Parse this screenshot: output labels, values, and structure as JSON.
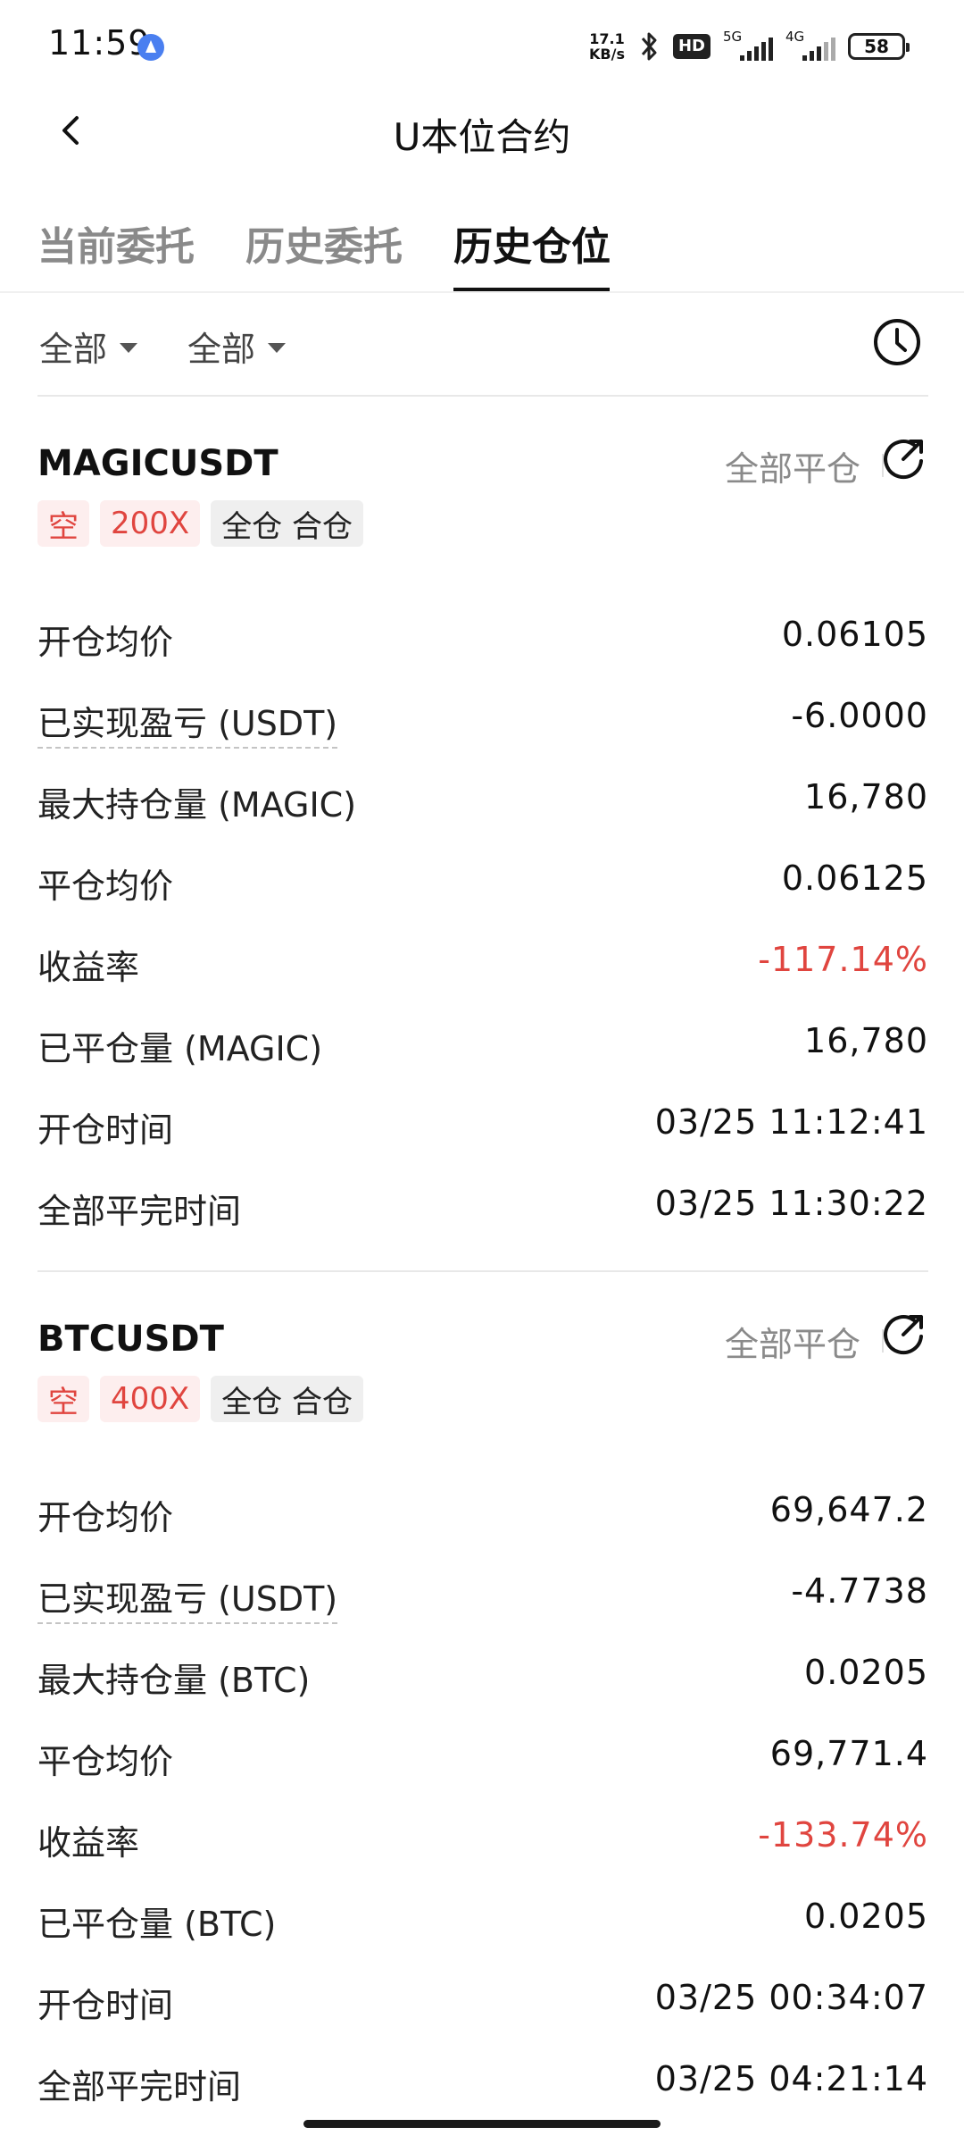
{
  "status_bar": {
    "time": "11:59",
    "net_speed_value": "17.1",
    "net_speed_unit": "KB/s",
    "hd_label": "HD",
    "signal_1_label": "5G",
    "signal_2_label": "4G",
    "battery_level": "58"
  },
  "header": {
    "title": "U本位合约",
    "back_icon": "chevron-left-icon"
  },
  "tabs": [
    {
      "label": "当前委托",
      "active": false
    },
    {
      "label": "历史委托",
      "active": false
    },
    {
      "label": "历史仓位",
      "active": true
    }
  ],
  "filters": [
    {
      "label": "全部"
    },
    {
      "label": "全部"
    }
  ],
  "history_icon": "clock-icon",
  "positions": [
    {
      "symbol": "MAGICUSDT",
      "close_all_label": "全部平仓",
      "share_icon": "share-icon",
      "badges": [
        "空",
        "200X",
        "全仓 合仓"
      ],
      "rows": [
        {
          "label": "开仓均价",
          "value": "0.06105"
        },
        {
          "label": "已实现盈亏 (USDT)",
          "value": "-6.0000"
        },
        {
          "label": "最大持仓量 (MAGIC)",
          "value": "16,780"
        },
        {
          "label": "平仓均价",
          "value": "0.06125"
        },
        {
          "label": "收益率",
          "value": "-117.14%"
        },
        {
          "label": "已平仓量 (MAGIC)",
          "value": "16,780"
        },
        {
          "label": "开仓时间",
          "value": "03/25 11:12:41"
        },
        {
          "label": "全部平完时间",
          "value": "03/25 11:30:22"
        }
      ]
    },
    {
      "symbol": "BTCUSDT",
      "close_all_label": "全部平仓",
      "share_icon": "share-icon",
      "badges": [
        "空",
        "400X",
        "全仓 合仓"
      ],
      "rows": [
        {
          "label": "开仓均价",
          "value": "69,647.2"
        },
        {
          "label": "已实现盈亏 (USDT)",
          "value": "-4.7738"
        },
        {
          "label": "最大持仓量 (BTC)",
          "value": "0.0205"
        },
        {
          "label": "平仓均价",
          "value": "69,771.4"
        },
        {
          "label": "收益率",
          "value": "-133.74%"
        },
        {
          "label": "已平仓量 (BTC)",
          "value": "0.0205"
        },
        {
          "label": "开仓时间",
          "value": "03/25 00:34:07"
        },
        {
          "label": "全部平完时间",
          "value": "03/25 04:21:14"
        }
      ]
    }
  ],
  "colors": {
    "negative": "#e0453f",
    "badge_red_bg": "#fdeeee",
    "badge_gray_bg": "#efefef",
    "muted_text": "#8a8a8a"
  }
}
